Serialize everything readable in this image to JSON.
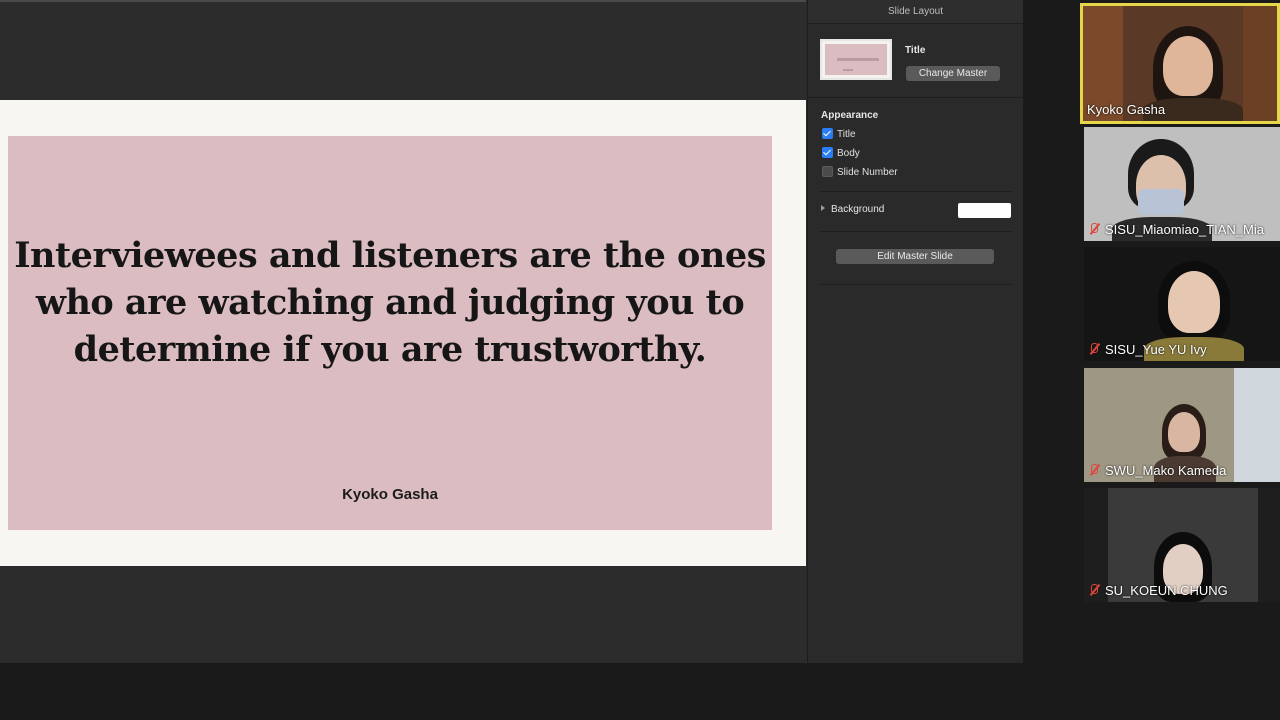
{
  "slide": {
    "title": "Interviewees and listeners are the ones who are watching and judging you to determine if you are trustworthy.",
    "body": "Kyoko Gasha"
  },
  "inspector": {
    "header": "Slide Layout",
    "master_label": "Title",
    "change_master": "Change Master",
    "appearance_label": "Appearance",
    "options": [
      {
        "label": "Title",
        "checked": true
      },
      {
        "label": "Body",
        "checked": true
      },
      {
        "label": "Slide Number",
        "checked": false
      }
    ],
    "background_label": "Background",
    "background_color": "#ffffff",
    "edit_master": "Edit Master Slide"
  },
  "participants": [
    {
      "name": "Kyoko Gasha",
      "muted": false,
      "active": true
    },
    {
      "name": "SISU_Miaomiao_TIAN_Mia",
      "muted": true,
      "active": false
    },
    {
      "name": "SISU_Yue YU Ivy",
      "muted": true,
      "active": false
    },
    {
      "name": "SWU_Mako Kameda",
      "muted": true,
      "active": false
    },
    {
      "name": "SU_KOEUN CHUNG",
      "muted": true,
      "active": false
    }
  ]
}
